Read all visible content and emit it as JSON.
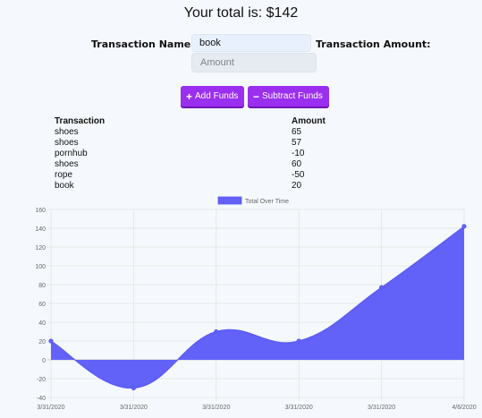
{
  "header": {
    "total_text": "Your total is: $142"
  },
  "form": {
    "name_label": "Transaction Name:",
    "name_value": "book",
    "amount_label": "Transaction Amount:",
    "amount_placeholder": "Amount"
  },
  "buttons": {
    "add_label": "Add Funds",
    "add_icon": "plus-icon",
    "subtract_label": "Subtract Funds",
    "subtract_icon": "minus-icon",
    "color": "#9a2ff0"
  },
  "table": {
    "headers": [
      "Transaction",
      "Amount"
    ],
    "rows": [
      [
        "shoes",
        "65"
      ],
      [
        "shoes",
        "57"
      ],
      [
        "pornhub",
        "-10"
      ],
      [
        "shoes",
        "60"
      ],
      [
        "rope",
        "-50"
      ],
      [
        "book",
        "20"
      ]
    ]
  },
  "chart_data": {
    "type": "area",
    "legend": "Total Over Time",
    "legend_position": "top",
    "x_labels": [
      "3/31/2020",
      "3/31/2020",
      "3/31/2020",
      "3/31/2020",
      "3/31/2020",
      "4/6/2020"
    ],
    "values": [
      20,
      -30,
      30,
      20,
      77,
      142
    ],
    "y_ticks": [
      160,
      140,
      120,
      100,
      80,
      60,
      40,
      20,
      0,
      -20,
      -40
    ],
    "ylim": [
      -40,
      160
    ],
    "grid": true,
    "fill_color": "#6262f9"
  }
}
